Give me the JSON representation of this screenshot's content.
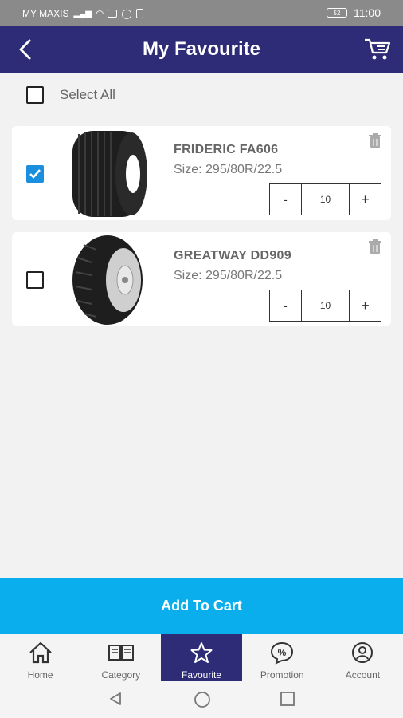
{
  "status_bar": {
    "carrier": "MY MAXIS",
    "battery": "52",
    "time": "11:00"
  },
  "header": {
    "title": "My Favourite",
    "back_icon": "chevron-left-icon",
    "cart_icon": "cart-icon"
  },
  "select_all": {
    "label": "Select All",
    "checked": false
  },
  "items": [
    {
      "name": "FRIDERIC FA606",
      "size": "Size: 295/80R/22.5",
      "quantity": "10",
      "checked": true,
      "minus": "-",
      "plus": "+"
    },
    {
      "name": "GREATWAY DD909",
      "size": "Size: 295/80R/22.5",
      "quantity": "10",
      "checked": false,
      "minus": "-",
      "plus": "+"
    }
  ],
  "add_to_cart": "Add To Cart",
  "nav": [
    {
      "label": "Home",
      "icon": "home-icon"
    },
    {
      "label": "Category",
      "icon": "book-icon"
    },
    {
      "label": "Favourite",
      "icon": "star-icon",
      "active": true
    },
    {
      "label": "Promotion",
      "icon": "percent-icon"
    },
    {
      "label": "Account",
      "icon": "user-icon"
    }
  ],
  "colors": {
    "header": "#2e2c77",
    "accent": "#0aaeec",
    "checkbox": "#1a8fe0",
    "background": "#f2f2f2"
  }
}
